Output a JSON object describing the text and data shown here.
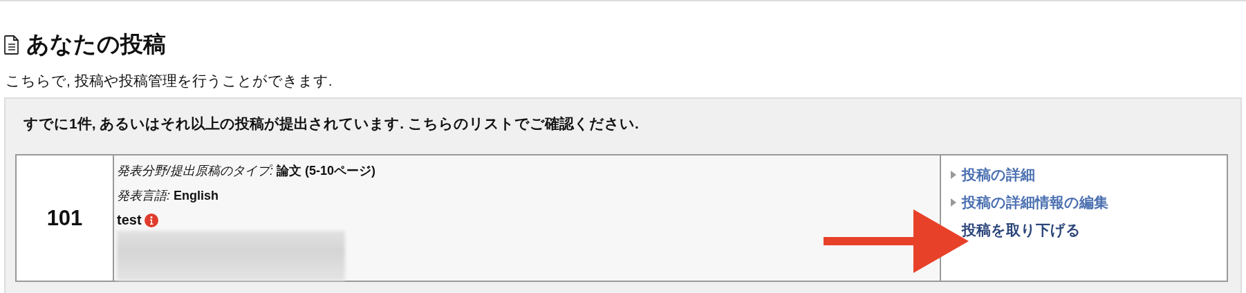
{
  "page": {
    "title": "あなたの投稿",
    "description": "こちらで, 投稿や投稿管理を行うことができます."
  },
  "panel": {
    "notice": "すでに1件, あるいはそれ以上の投稿が提出されています. こちらのリストでご確認ください.",
    "submissions": [
      {
        "number": "101",
        "fields": [
          {
            "label": "発表分野/提出原稿のタイプ:",
            "value": "論文 (5-10ページ)"
          },
          {
            "label": "発表言語:",
            "value": "English"
          }
        ],
        "title": "test",
        "links": [
          {
            "label": "投稿の詳細",
            "hovered": false
          },
          {
            "label": "投稿の詳細情報の編集",
            "hovered": false
          },
          {
            "label": "投稿を取り下げる",
            "hovered": true
          }
        ]
      }
    ]
  }
}
